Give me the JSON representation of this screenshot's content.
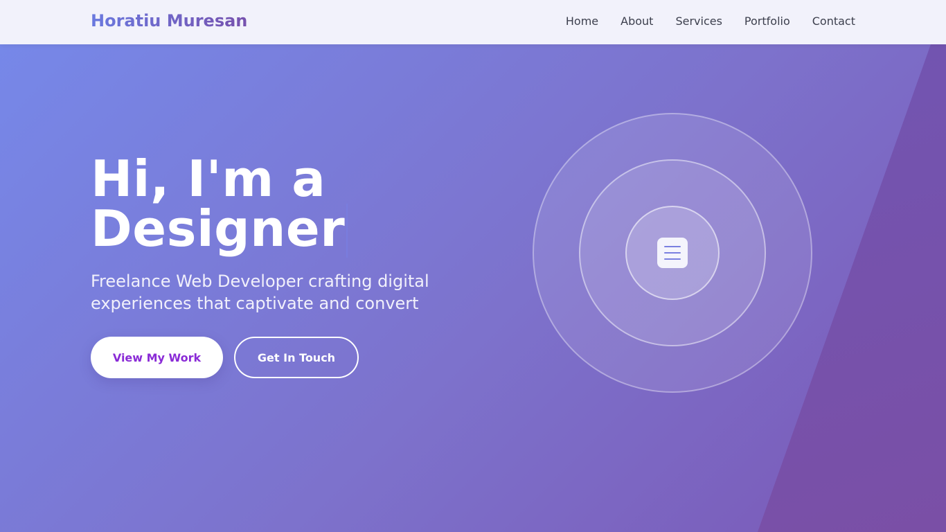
{
  "header": {
    "brand": "Horatiu Muresan",
    "nav": [
      "Home",
      "About",
      "Services",
      "Portfolio",
      "Contact"
    ]
  },
  "hero": {
    "title_line1": "Hi, I'm a",
    "title_line2": "Designer",
    "subtitle": "Freelance Web Developer crafting digital experiences that captivate and convert",
    "primary_button": "View My Work",
    "secondary_button": "Get In Touch"
  },
  "graphic": {
    "center_icon": "document-icon"
  },
  "colors": {
    "brand_start": "#6a79df",
    "brand_end": "#7651ae",
    "primary_button_text": "#8a2bd6",
    "bg_start": "#7689ea",
    "bg_end": "#7a58b6"
  }
}
